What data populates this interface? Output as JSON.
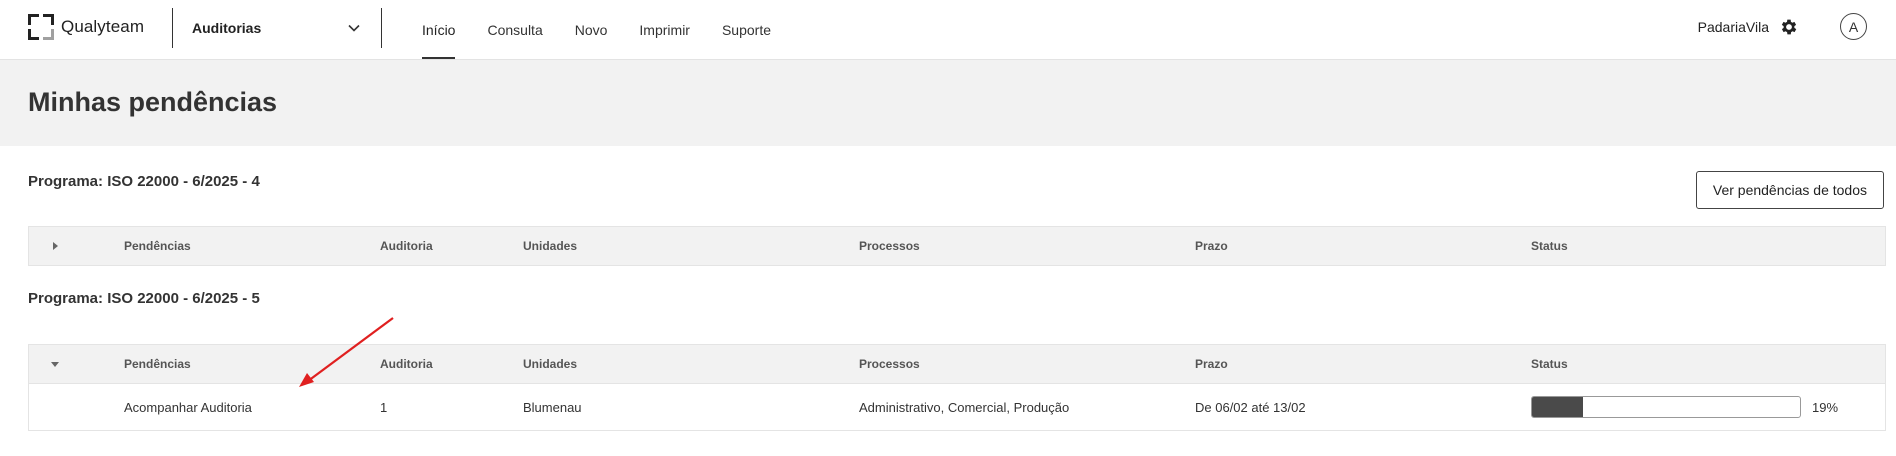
{
  "brand": {
    "name": "Qualyteam"
  },
  "module": {
    "label": "Auditorias"
  },
  "nav": [
    {
      "label": "Início",
      "active": true
    },
    {
      "label": "Consulta",
      "active": false
    },
    {
      "label": "Novo",
      "active": false
    },
    {
      "label": "Imprimir",
      "active": false
    },
    {
      "label": "Suporte",
      "active": false
    }
  ],
  "user": {
    "name": "PadariaVila",
    "avatar_initial": "A",
    "settings_icon": "gear-icon"
  },
  "page": {
    "title": "Minhas pendências"
  },
  "actions": {
    "view_all_label": "Ver pendências de todos"
  },
  "columns": [
    "Pendências",
    "Auditoria",
    "Unidades",
    "Processos",
    "Prazo",
    "Status"
  ],
  "programs": [
    {
      "title": "Programa: ISO 22000 - 6/2025 - 4",
      "expanded": false,
      "rows": []
    },
    {
      "title": "Programa: ISO 22000 - 6/2025 - 5",
      "expanded": true,
      "rows": [
        {
          "pendencia": "Acompanhar Auditoria",
          "auditoria": "1",
          "unidades": "Blumenau",
          "processos": "Administrativo, Comercial, Produção",
          "prazo": "De 06/02 até 13/02",
          "status_pct_label": "19%",
          "status_fraction": 0.19
        }
      ]
    }
  ],
  "colors": {
    "annotation_arrow": "#e02020",
    "progress_fill": "#4a4a4a"
  }
}
